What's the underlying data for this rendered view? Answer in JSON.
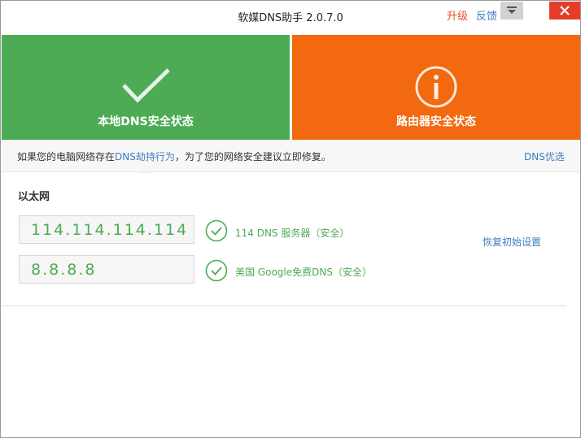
{
  "titlebar": {
    "title": "软媒DNS助手 2.0.7.0",
    "upgrade": "升级",
    "feedback": "反馈",
    "menu_icon": "dropdown-menu-icon",
    "close_icon": "close-icon"
  },
  "panels": {
    "local": {
      "label": "本地DNS安全状态",
      "icon": "checkmark-icon",
      "color": "#4dab55"
    },
    "router": {
      "label": "路由器安全状态",
      "icon": "info-circle-icon",
      "color": "#f2690f"
    }
  },
  "notice": {
    "text_before": "如果您的电脑网络存在",
    "link": "DNS劫持行为",
    "text_after": "，为了您的网络安全建议立即修复。",
    "dns_optimize": "DNS优选"
  },
  "ethernet": {
    "title": "以太网",
    "servers": [
      {
        "address": "114.114.114.114",
        "status": "114 DNS 服务器（安全）"
      },
      {
        "address": "8.8.8.8",
        "status": "美国 Google免费DNS（安全）"
      }
    ],
    "restore": "恢复初始设置"
  },
  "colors": {
    "safe": "#4dab55",
    "warn": "#f2690f",
    "link": "#3f7dbf",
    "close": "#e53c29"
  }
}
